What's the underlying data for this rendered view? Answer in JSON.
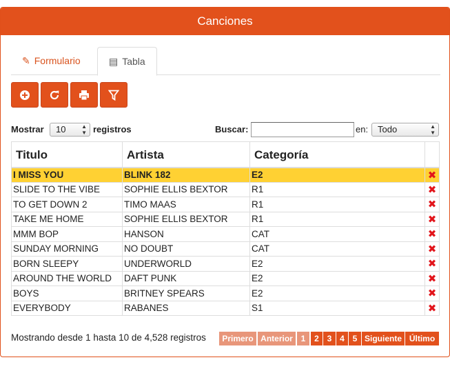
{
  "panel": {
    "title": "Canciones"
  },
  "tabs": {
    "form_label": "Formulario",
    "table_label": "Tabla"
  },
  "toolbar": {
    "buttons": [
      {
        "name": "add-button",
        "icon": "plus-circle-icon"
      },
      {
        "name": "refresh-button",
        "icon": "refresh-icon"
      },
      {
        "name": "print-button",
        "icon": "print-icon"
      },
      {
        "name": "filter-button",
        "icon": "filter-icon"
      }
    ]
  },
  "controls": {
    "show_label": "Mostrar",
    "page_size": "10",
    "records_label": "registros",
    "search_label": "Buscar:",
    "search_value": "",
    "in_label": "en:",
    "in_value": "Todo"
  },
  "table": {
    "columns": [
      "Titulo",
      "Artista",
      "Categoría"
    ],
    "rows": [
      {
        "titulo": "I MISS YOU",
        "artista": "BLINK 182",
        "categoria": "E2",
        "selected": true
      },
      {
        "titulo": "SLIDE TO THE VIBE",
        "artista": "SOPHIE ELLIS BEXTOR",
        "categoria": "R1"
      },
      {
        "titulo": "TO GET DOWN 2",
        "artista": "TIMO MAAS",
        "categoria": "R1"
      },
      {
        "titulo": "TAKE ME HOME",
        "artista": "SOPHIE ELLIS BEXTOR",
        "categoria": "R1"
      },
      {
        "titulo": "MMM BOP",
        "artista": "HANSON",
        "categoria": "CAT"
      },
      {
        "titulo": "SUNDAY MORNING",
        "artista": "NO DOUBT",
        "categoria": "CAT"
      },
      {
        "titulo": "BORN SLEEPY",
        "artista": "UNDERWORLD",
        "categoria": "E2"
      },
      {
        "titulo": "AROUND THE WORLD",
        "artista": "DAFT PUNK",
        "categoria": "E2"
      },
      {
        "titulo": "BOYS",
        "artista": "BRITNEY SPEARS",
        "categoria": "E2"
      },
      {
        "titulo": "EVERYBODY",
        "artista": "RABANES",
        "categoria": "S1"
      }
    ],
    "delete_glyph": "✖"
  },
  "footer": {
    "info": "Mostrando desde 1 hasta 10 de 4,528 registros",
    "pager": {
      "first": "Primero",
      "prev": "Anterior",
      "pages": [
        "1",
        "2",
        "3",
        "4",
        "5"
      ],
      "next": "Siguiente",
      "last": "Último"
    }
  },
  "colors": {
    "accent": "#e2511c",
    "selected_row": "#ffd133",
    "delete": "#e2151b"
  }
}
